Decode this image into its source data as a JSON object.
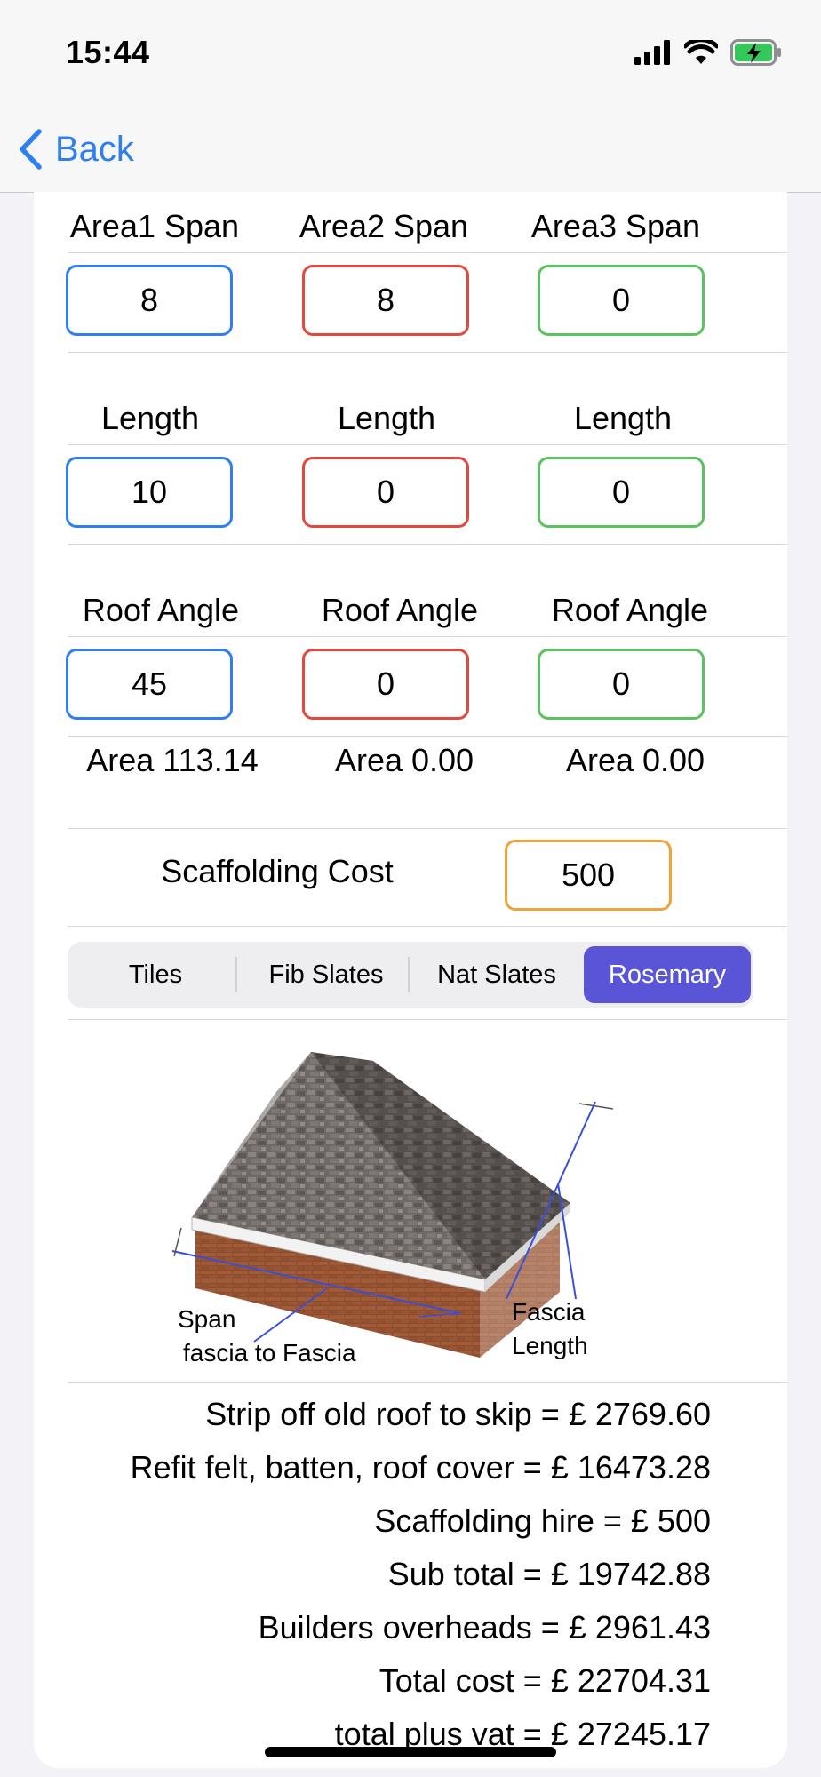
{
  "status_bar": {
    "time": "15:44"
  },
  "nav": {
    "back_label": "Back"
  },
  "areas": [
    {
      "span_label": "Area1 Span",
      "span_value": "8",
      "length_label": "Length",
      "length_value": "10",
      "angle_label": "Roof Angle",
      "angle_value": "45",
      "area_text": "Area 113.14",
      "color": "#2f7ff0"
    },
    {
      "span_label": "Area2 Span",
      "span_value": "8",
      "length_label": "Length",
      "length_value": "0",
      "angle_label": "Roof Angle",
      "angle_value": "0",
      "area_text": "Area 0.00",
      "color": "#e2483c"
    },
    {
      "span_label": "Area3 Span",
      "span_value": "0",
      "length_label": "Length",
      "length_value": "0",
      "angle_label": "Roof Angle",
      "angle_value": "0",
      "area_text": "Area 0.00",
      "color": "#5ac25e"
    }
  ],
  "scaffolding": {
    "label": "Scaffolding Cost",
    "value": "500",
    "color": "#f0a33a"
  },
  "material_segments": {
    "options": [
      "Tiles",
      "Fib Slates",
      "Nat Slates",
      "Rosemary"
    ],
    "selected": "Rosemary",
    "selected_color": "#5a55d6"
  },
  "diagram": {
    "span_label_line1": "Span",
    "span_label_line2": "fascia to Fascia",
    "fascia_label_line1": "Fascia",
    "fascia_label_line2": "Length"
  },
  "results": [
    "Strip off old roof to skip = £ 2769.60",
    "Refit felt, batten, roof cover = £ 16473.28",
    "Scaffolding hire = £ 500",
    "Sub total = £ 19742.88",
    "Builders overheads = £ 2961.43",
    "Total cost = £ 22704.31",
    "total plus vat = £ 27245.17"
  ],
  "icons": {
    "signal": "cellular-signal-icon",
    "wifi": "wifi-icon",
    "battery": "battery-charging-icon",
    "back": "chevron-left-icon"
  },
  "accent_color": "#2f7ff0"
}
